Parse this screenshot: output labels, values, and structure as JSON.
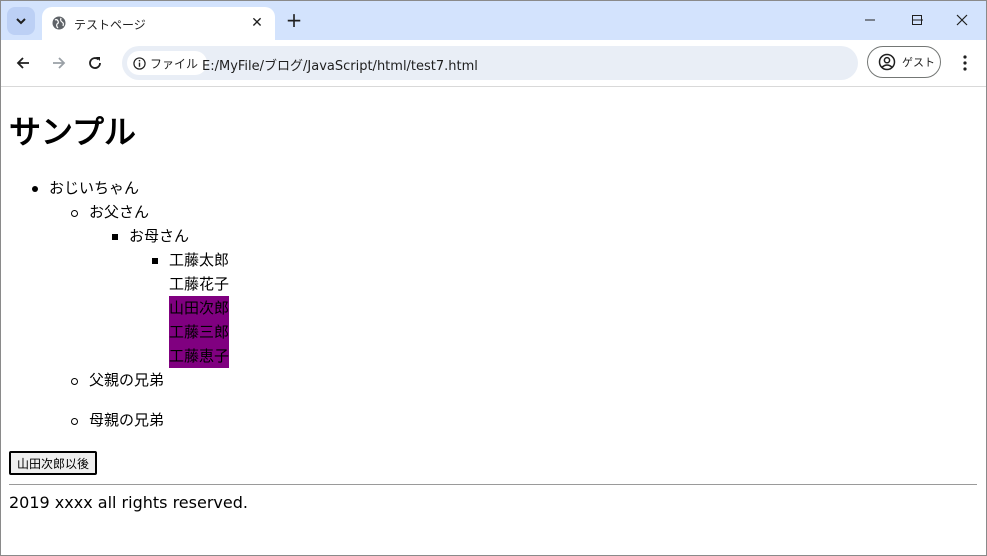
{
  "browser": {
    "tab": {
      "title": "テストページ"
    },
    "address": {
      "chip_label": "ファイル",
      "url": "E:/MyFile/ブログ/JavaScript/html/test7.html"
    },
    "profile_label": "ゲスト"
  },
  "page": {
    "heading": "サンプル",
    "tree": {
      "grandpa": "おじいちゃん",
      "father": "お父さん",
      "mother": "お母さん",
      "children": [
        "工藤太郎",
        "工藤花子",
        "山田次郎",
        "工藤三郎",
        "工藤恵子"
      ],
      "father_siblings": "父親の兄弟",
      "mother_siblings": "母親の兄弟"
    },
    "button_label": "山田次郎以後",
    "footer": "2019 xxxx all rights reserved.",
    "highlight_color": "#800080"
  }
}
